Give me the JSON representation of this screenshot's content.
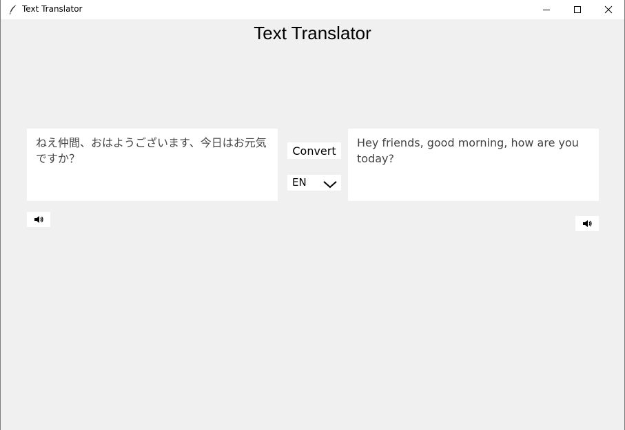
{
  "window": {
    "title": "Text Translator",
    "icons": {
      "app": "feather-icon",
      "minimize": "minimize-icon",
      "maximize": "maximize-icon",
      "close": "close-icon"
    }
  },
  "main": {
    "heading": "Text Translator",
    "source_text": "ねえ仲間、おはようございます、今日はお元気ですか？",
    "translated_text": "Hey friends, good morning, how are you today?",
    "convert_label": "Convert",
    "language": {
      "selected": "EN",
      "icon": "chevron-down-icon"
    },
    "speaker_icon": "speaker-icon"
  }
}
